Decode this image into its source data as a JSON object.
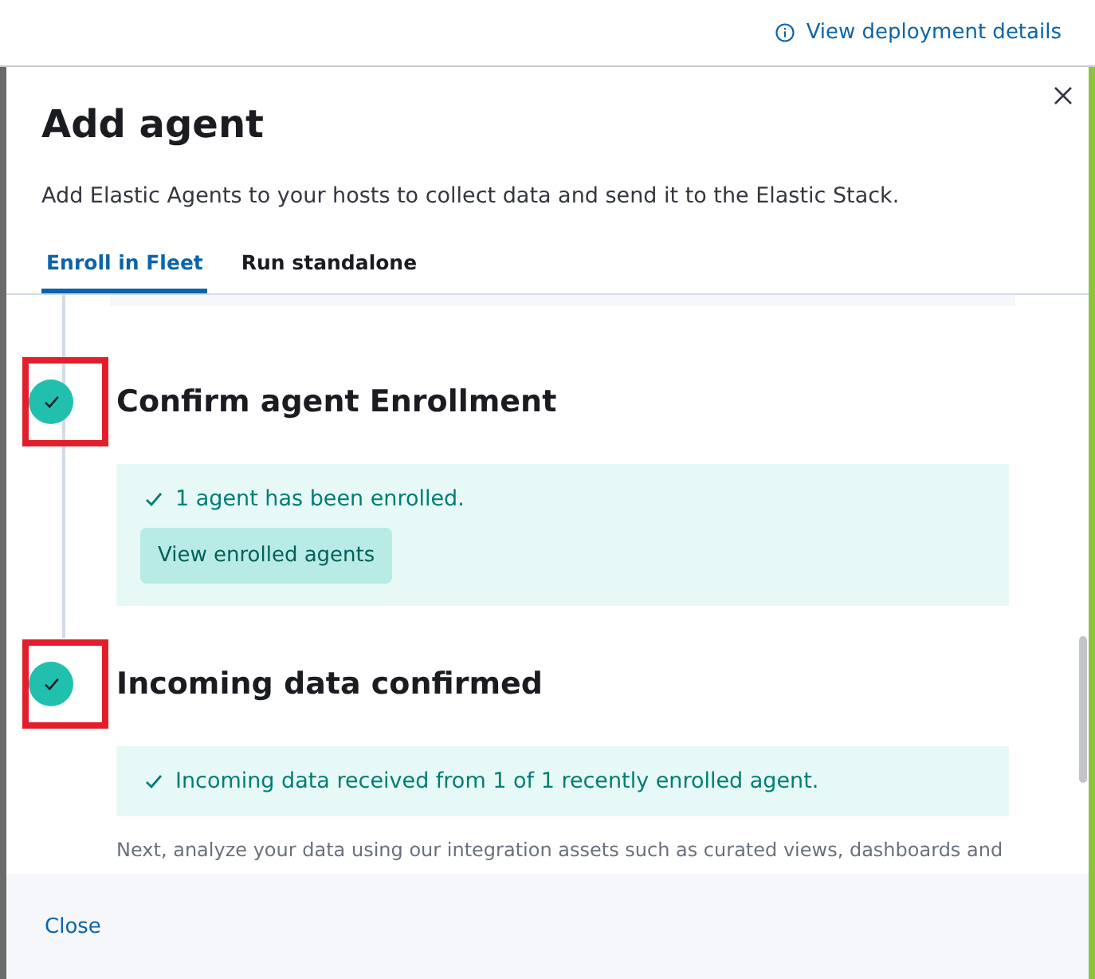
{
  "top_bar": {
    "link": "View deployment details"
  },
  "flyout": {
    "title": "Add agent",
    "description": "Add Elastic Agents to your hosts to collect data and send it to the Elastic Stack.",
    "tabs": [
      {
        "label": "Enroll in Fleet",
        "selected": true
      },
      {
        "label": "Run standalone",
        "selected": false
      }
    ],
    "steps": [
      {
        "title": "Confirm agent Enrollment",
        "complete": true,
        "highlighted": true,
        "callout": {
          "message": "1 agent has been enrolled.",
          "button": "View enrolled agents"
        }
      },
      {
        "title": "Incoming data confirmed",
        "complete": true,
        "highlighted": true,
        "callout": {
          "message": "Incoming data received from 1 of 1 recently enrolled agent."
        },
        "text": "Next, analyze your data using our integration assets such as curated views, dashboards and"
      }
    ],
    "footer": {
      "close": "Close"
    }
  }
}
